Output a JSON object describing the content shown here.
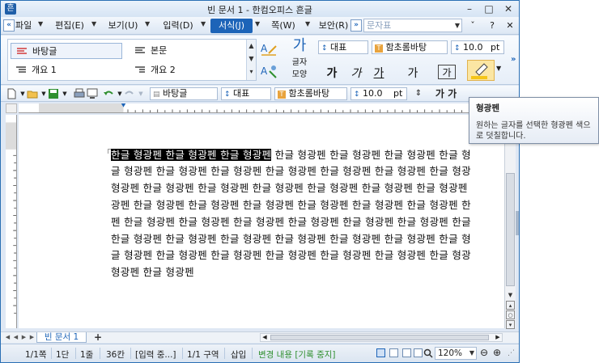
{
  "window": {
    "title": "빈 문서 1 - 한컴오피스 흔글",
    "controls": {
      "minimize": "–",
      "maximize": "□",
      "close": "✕"
    }
  },
  "menu": {
    "left_chevron": "«",
    "items": [
      {
        "label": "파일(F)"
      },
      {
        "label": "편집(E)"
      },
      {
        "label": "보기(U)"
      },
      {
        "label": "입력(D)"
      },
      {
        "label": "서식(J)",
        "active": true
      },
      {
        "label": "쪽(W)"
      },
      {
        "label": "보안(R)"
      }
    ],
    "right_chevron": "»",
    "style_box_placeholder": "문자표",
    "help": "?",
    "collapse": "ˇ"
  },
  "ribbon": {
    "styles": [
      {
        "label": "바탕글",
        "selected": true
      },
      {
        "label": "본문"
      },
      {
        "label": "개요 1"
      },
      {
        "label": "개요 2"
      }
    ],
    "char_shape_label_1": "글자",
    "char_shape_label_2": "모양",
    "char_shape_glyph": "가",
    "lang_combo": "대표",
    "font_combo": "함초롬바탕",
    "size_combo": "10.0",
    "size_unit": "pt",
    "format_buttons": [
      "가",
      "가",
      "가",
      "가",
      "가"
    ],
    "highlight_color": "#f5c518"
  },
  "toolbar2": {
    "style_combo": "바탕글",
    "lang_combo": "대표",
    "font_combo": "함초롬바탕",
    "size_combo": "10.0",
    "size_unit": "pt",
    "format_glyph": "가 가"
  },
  "document": {
    "lines": [
      {
        "highlight": "한글 형광펜 한글 형광펜 한글 형광펜",
        "text": " 한글 형광펜 한글 형광펜 한글 형광펜 한글 형"
      },
      {
        "text": "글 형광펜 한글 형광펜 한글 형광펜 한글 형광펜 한글 형광펜 한글 형광펜 한글 형광"
      },
      {
        "text": "형광펜 한글 형광펜 한글 형광펜 한글 형광펜 한글 형광펜 한글 형광펜 한글 형광펜"
      },
      {
        "text": "광펜 한글 형광펜 한글 형광펜 한글 형광펜 한글 형광펜 한글 형광펜 한글 형광펜 한"
      },
      {
        "text": "펜 한글 형광펜 한글 형광펜 한글 형광펜 한글 형광펜 한글 형광펜 한글 형광펜 한글"
      },
      {
        "text": "한글 형광펜 한글 형광펜 한글 형광펜 한글 형광펜 한글 형광펜 한글 형광펜 한글 형"
      },
      {
        "text": "글 형광펜 한글 형광펜 한글 형광펜 한글 형광펜 한글 형광펜 한글 형광펜 한글 형광"
      },
      {
        "text": "형광펜 한글 형광펜"
      }
    ]
  },
  "tabs": {
    "doc_tab": "빈 문서 1",
    "add_tab": "+"
  },
  "status": {
    "page": "1/1쪽",
    "column": "1단",
    "line": "1줄",
    "char": "36칸",
    "input_mode": "[입력 중...]",
    "section": "1/1 구역",
    "insert_mode": "삽입",
    "track_changes": "변경 내용 [기록 중지]",
    "zoom": "120%"
  },
  "tooltip": {
    "title": "형광펜",
    "description": "원하는 글자를 선택한 형광펜 색으로 덧칠합니다."
  }
}
